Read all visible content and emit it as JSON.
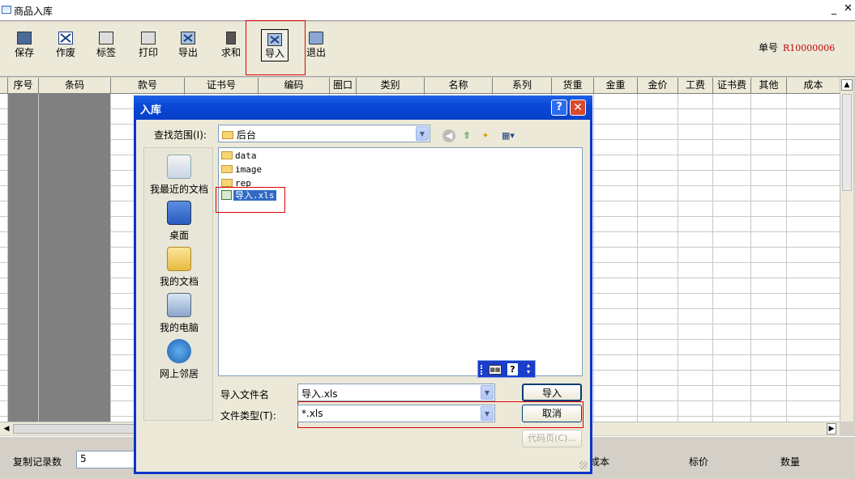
{
  "window": {
    "title": "商品入库"
  },
  "toolbar": {
    "items": [
      {
        "label": "保存",
        "icon": "floppy-icon"
      },
      {
        "label": "作废",
        "icon": "void-icon"
      },
      {
        "label": "标签",
        "icon": "label-printer-icon"
      },
      {
        "label": "打印",
        "icon": "printer-icon"
      },
      {
        "label": "导出",
        "icon": "export-icon"
      },
      {
        "label": "求和",
        "icon": "sum-icon"
      },
      {
        "label": "导入",
        "icon": "import-icon"
      },
      {
        "label": "退出",
        "icon": "exit-icon"
      }
    ],
    "order_label": "单号",
    "order_value": "R10000006"
  },
  "grid": {
    "columns": [
      "序号",
      "条码",
      "款号",
      "证书号",
      "编码",
      "圈口",
      "类别",
      "名称",
      "系列",
      "货重",
      "金重",
      "金价",
      "工费",
      "证书费",
      "其他",
      "成本"
    ]
  },
  "footer": {
    "copy_label": "复制记录数",
    "copy_value": "5",
    "cost_label": "成本",
    "price_label": "标价",
    "qty_label": "数量"
  },
  "dialog": {
    "title": "入库",
    "look_in_label": "查找范围(I):",
    "look_in_value": "后台",
    "places": [
      "我最近的文档",
      "桌面",
      "我的文档",
      "我的电脑",
      "网上邻居"
    ],
    "files": [
      {
        "name": "data",
        "type": "folder"
      },
      {
        "name": "image",
        "type": "folder"
      },
      {
        "name": "rep",
        "type": "folder"
      },
      {
        "name": "导入.xls",
        "type": "excel"
      }
    ],
    "filename_label": "导入文件名",
    "filename_value": "导入.xls",
    "filetype_label": "文件类型(T):",
    "filetype_value": "*.xls",
    "import_button": "导入",
    "cancel_button": "取消",
    "codepage_button": "代码页(C)..."
  },
  "colors": {
    "highlight": "#e00000",
    "title_blue": "#0a48d8",
    "order_red": "#c00000",
    "selection": "#316ac5"
  }
}
